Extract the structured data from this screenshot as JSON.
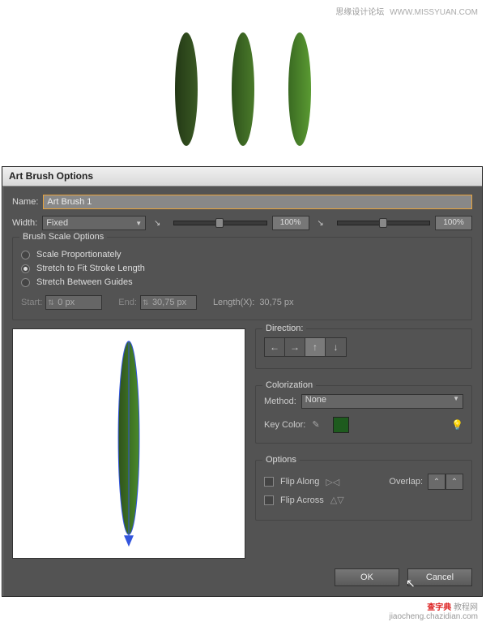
{
  "watermark": {
    "top_cn": "思缘设计论坛",
    "top_url": "WWW.MISSYUAN.COM",
    "bottom_brand": "查字典",
    "bottom_sub": "教程网",
    "bottom_url": "jiaocheng.chazidian.com"
  },
  "dialog": {
    "title": "Art Brush Options",
    "name_label": "Name:",
    "name_value": "Art Brush 1",
    "width_label": "Width:",
    "width_mode": "Fixed",
    "pct1": "100%",
    "pct2": "100%",
    "scale_legend": "Brush Scale Options",
    "scale_opt1": "Scale Proportionately",
    "scale_opt2": "Stretch to Fit Stroke Length",
    "scale_opt3": "Stretch Between Guides",
    "start_label": "Start:",
    "start_val": "0 px",
    "end_label": "End:",
    "end_val": "30,75 px",
    "length_label": "Length(X):",
    "length_val": "30,75 px",
    "direction_legend": "Direction:",
    "colorization_legend": "Colorization",
    "method_label": "Method:",
    "method_value": "None",
    "keycolor_label": "Key Color:",
    "options_legend": "Options",
    "flip_along": "Flip Along",
    "flip_across": "Flip Across",
    "overlap_label": "Overlap:",
    "ok": "OK",
    "cancel": "Cancel"
  },
  "colors": {
    "leaf1": "#2e4a1e",
    "leaf2": "#3a6a22",
    "leaf3": "#4a8a2a",
    "swatch": "#1e5b1e"
  }
}
